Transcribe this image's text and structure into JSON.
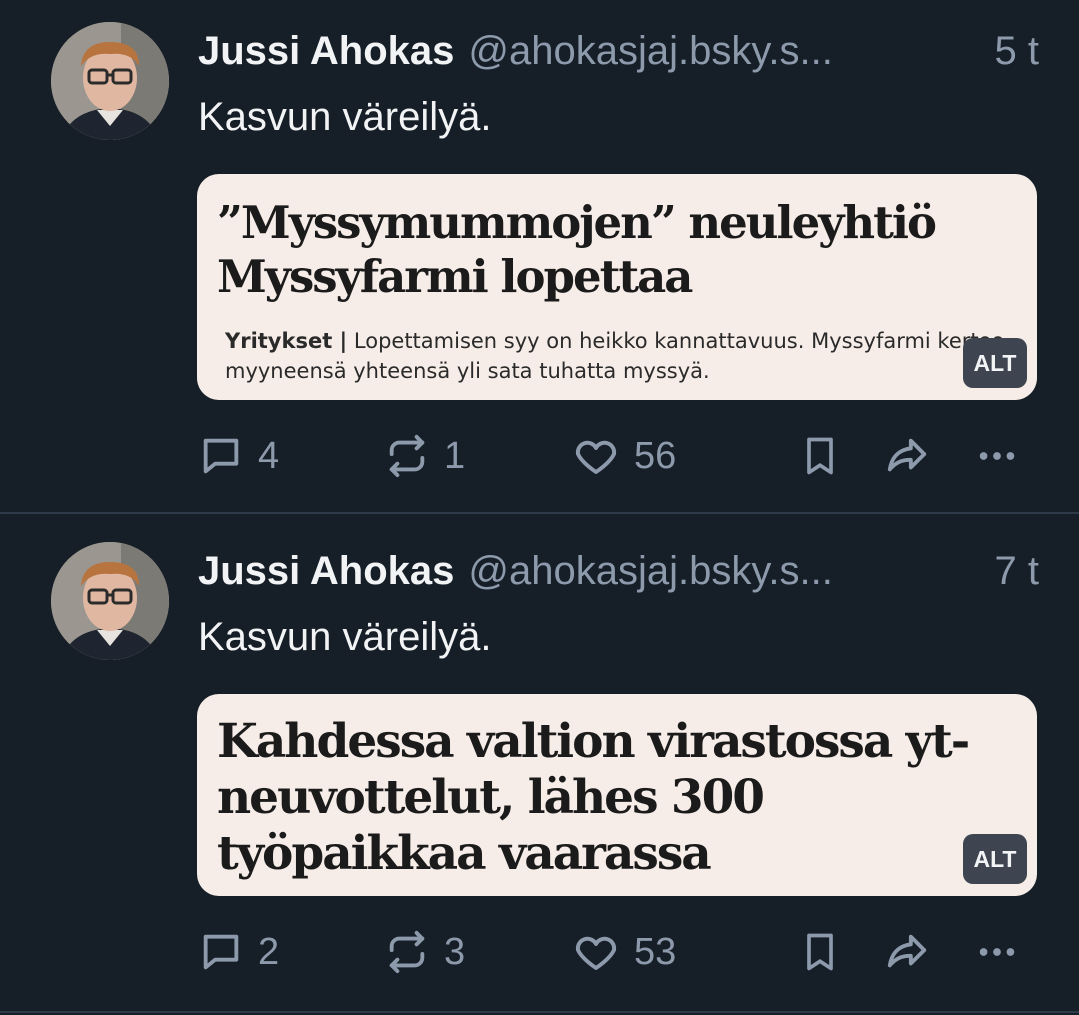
{
  "posts": [
    {
      "author": {
        "name": "Jussi Ahokas",
        "handle": "@ahokasjaj.bsky.s...",
        "time": "5 t"
      },
      "text": "Kasvun väreilyä.",
      "card": {
        "headline": "”Myssymummojen” neuleyhtiö Myssyfarmi lopettaa",
        "category": "Yritykset |",
        "summary": " Lopettamisen syy on heikko kannattavuus. Myssyfarmi kertoo myyneensä yhteensä yli sata tuhatta myssyä.",
        "alt_label": "ALT"
      },
      "stats": {
        "replies": "4",
        "reposts": "1",
        "likes": "56"
      }
    },
    {
      "author": {
        "name": "Jussi Ahokas",
        "handle": "@ahokasjaj.bsky.s...",
        "time": "7 t"
      },
      "text": "Kasvun väreilyä.",
      "card": {
        "headline": "Kahdessa valtion virastossa yt-neuvottelut, lähes 300 työpaikkaa vaarassa",
        "alt_label": "ALT"
      },
      "stats": {
        "replies": "2",
        "reposts": "3",
        "likes": "53"
      }
    }
  ],
  "icons": {
    "reply": "speech-bubble-icon",
    "repost": "repost-arrows-icon",
    "like": "heart-icon",
    "bookmark": "bookmark-icon",
    "share": "share-arrow-icon",
    "more": "more-dots-icon"
  },
  "colors": {
    "background": "#161e27",
    "text": "#f1f3f5",
    "muted": "#8c9aab",
    "card": "#f7ede8",
    "divider": "#2e3a48"
  }
}
